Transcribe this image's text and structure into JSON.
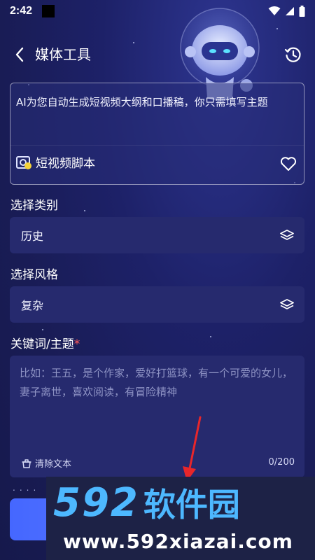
{
  "status_bar": {
    "time": "2:42"
  },
  "header": {
    "title": "媒体工具",
    "back_icon": "chevron-left-icon",
    "history_icon": "history-clock-icon"
  },
  "intro_card": {
    "description": "AI为您自动生成短视频大纲和口播稿，你只需填写主题",
    "tool_name": "短视频脚本",
    "tool_icon": "video-script-icon",
    "favorite_icon": "heart-outline-icon"
  },
  "category": {
    "label": "选择类别",
    "value": "历史",
    "icon": "layers-icon"
  },
  "style": {
    "label": "选择风格",
    "value": "复杂",
    "icon": "layers-icon"
  },
  "keywords": {
    "label": "关键词/主题",
    "required_mark": "*",
    "placeholder": "比如：王五，是个作家，爱好打篮球，有一个可爱的女儿，妻子离世，喜欢阅读，有冒险精神",
    "clear_label": "清除文本",
    "clear_icon": "eraser-icon",
    "counter": "0/200"
  },
  "bottom": {
    "dots": "...."
  },
  "watermark": {
    "logo_digits": "592",
    "logo_text": "软件园",
    "url": "www.592xiazai.com"
  },
  "colors": {
    "background": "#1c1f5a",
    "field_bg": "#262a6e",
    "accent": "#4567ff",
    "required": "#ff5a5a",
    "watermark_blue": "#4db8ff"
  }
}
